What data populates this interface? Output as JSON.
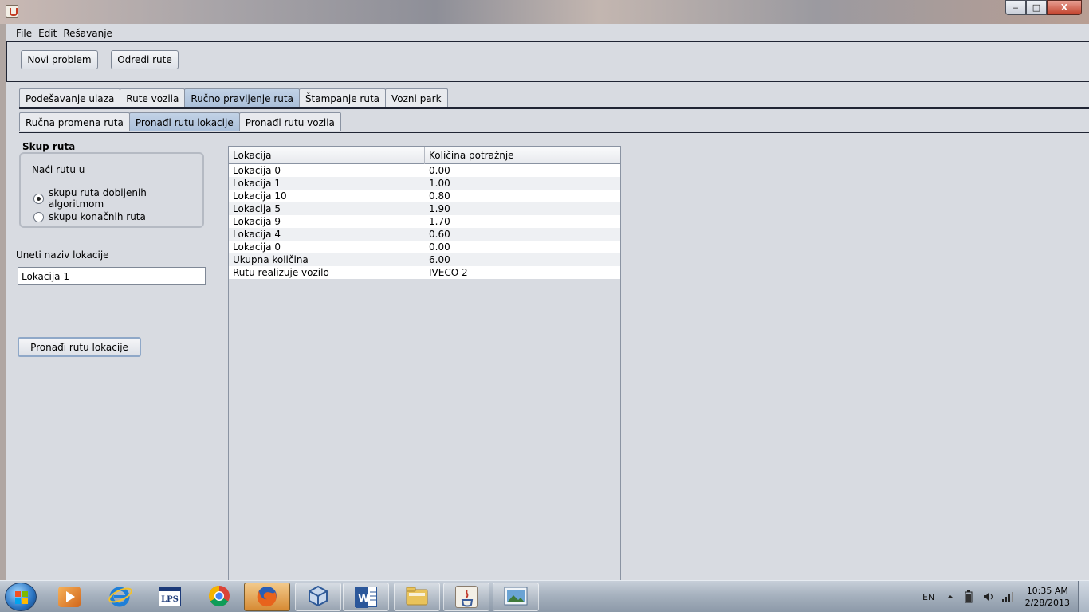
{
  "window": {
    "title": "",
    "controls": {
      "minimize": "‒",
      "maximize": "□",
      "close": "X"
    }
  },
  "menu": [
    "File",
    "Edit",
    "Rešavanje"
  ],
  "toolbar": {
    "new_problem": "Novi problem",
    "determine_routes": "Odredi rute"
  },
  "main_tabs": [
    "Podešavanje ulaza",
    "Rute vozila",
    "Ručno pravljenje ruta",
    "Štampanje ruta",
    "Vozni park"
  ],
  "main_tab_active": 2,
  "sub_tabs": [
    "Ručna promena ruta",
    "Pronađi rutu lokacije",
    "Pronađi rutu vozila"
  ],
  "sub_tab_active": 1,
  "left_panel": {
    "group_title": "Skup ruta",
    "group_subtitle": "Naći rutu u",
    "radio_options": [
      "skupu ruta dobijenih algoritmom",
      "skupu konačnih ruta"
    ],
    "radio_selected": 0,
    "location_label": "Uneti naziv lokacije",
    "location_value": "Lokacija 1",
    "find_button": "Pronađi rutu lokacije"
  },
  "table": {
    "columns": [
      "Lokacija",
      "Količina potražnje"
    ],
    "rows": [
      [
        "Lokacija 0",
        " 0.00"
      ],
      [
        "Lokacija 1",
        " 1.00"
      ],
      [
        "Lokacija 10",
        " 0.80"
      ],
      [
        "Lokacija 5",
        " 1.90"
      ],
      [
        "Lokacija 9",
        " 1.70"
      ],
      [
        "Lokacija 4",
        " 0.60"
      ],
      [
        "Lokacija 0",
        " 0.00"
      ],
      [
        "Ukupna količina",
        "6.00"
      ],
      [
        "Rutu realizuje vozilo",
        "IVECO 2"
      ]
    ]
  },
  "taskbar": {
    "apps": [
      {
        "name": "media-player-icon",
        "color": "#e08a2a"
      },
      {
        "name": "internet-explorer-icon",
        "color": "#2a7fd4"
      },
      {
        "name": "lps-icon",
        "label": "LPS"
      },
      {
        "name": "chrome-icon",
        "color": "#d93b2b"
      },
      {
        "name": "firefox-icon",
        "color": "#e2661e"
      },
      {
        "name": "virtualbox-icon",
        "color": "#3d6fb8"
      },
      {
        "name": "word-icon",
        "color": "#2b579a"
      },
      {
        "name": "explorer-folder-icon",
        "color": "#e8c45a"
      },
      {
        "name": "java-icon",
        "color": "#c0392b"
      },
      {
        "name": "photo-viewer-icon",
        "color": "#4a8bc9"
      }
    ],
    "language": "EN",
    "time": "10:35 AM",
    "date": "2/28/2013"
  }
}
